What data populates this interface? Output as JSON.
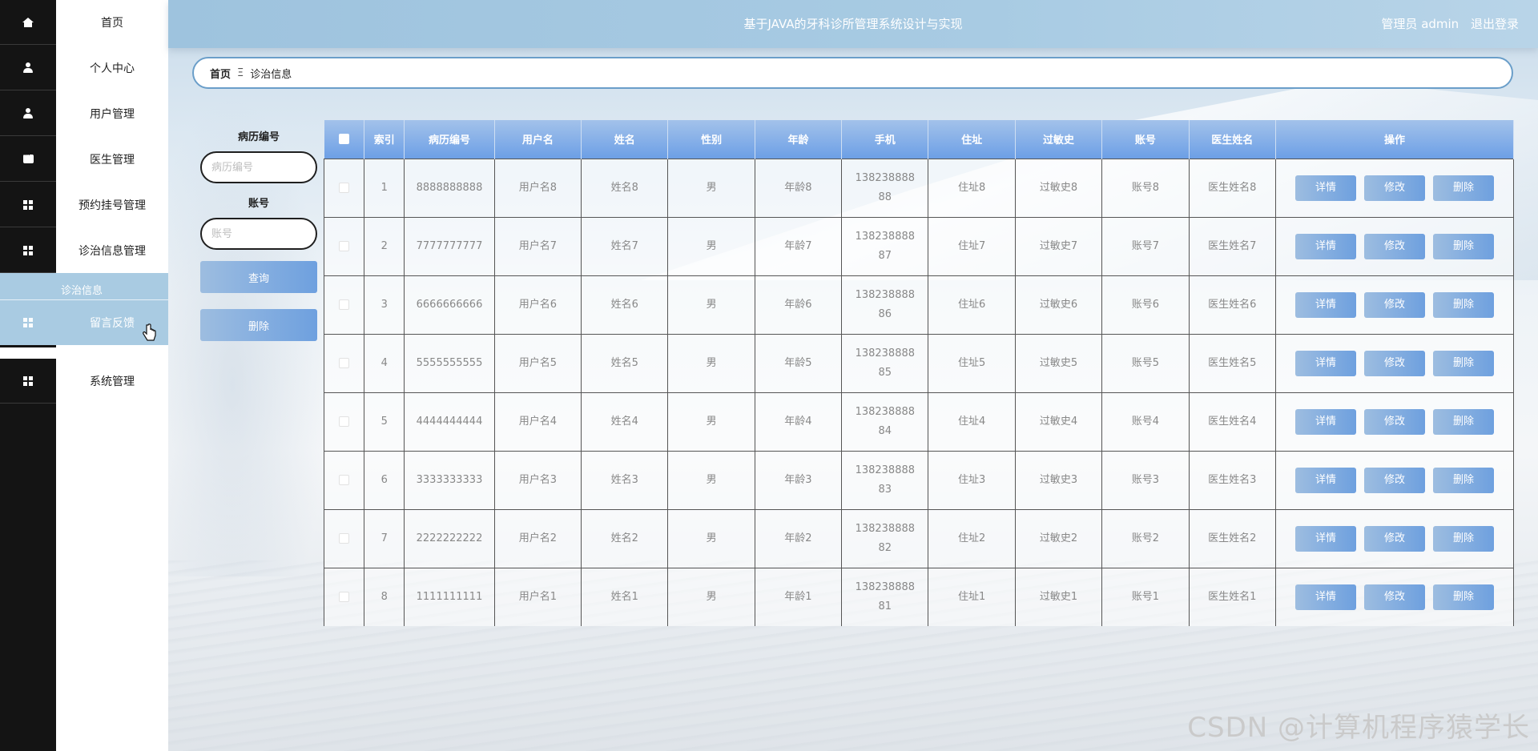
{
  "header": {
    "title": "基于JAVA的牙科诊所管理系统设计与实现",
    "user": "管理员 admin",
    "logout": "退出登录"
  },
  "sidebar": {
    "items": [
      {
        "label": "首页",
        "icon": "home-icon"
      },
      {
        "label": "个人中心",
        "icon": "user-icon"
      },
      {
        "label": "用户管理",
        "icon": "user-icon"
      },
      {
        "label": "医生管理",
        "icon": "chat-icon"
      },
      {
        "label": "预约挂号管理",
        "icon": "grid-icon"
      },
      {
        "label": "诊治信息管理",
        "icon": "grid-icon"
      },
      {
        "label": "留言反馈",
        "icon": "grid-icon"
      },
      {
        "label": "系统管理",
        "icon": "grid-icon"
      }
    ],
    "submenu_label": "诊治信息",
    "active_item": "留言反馈"
  },
  "breadcrumb": {
    "home": "首页",
    "separator": "Ξ",
    "current": "诊治信息"
  },
  "search": {
    "record_label": "病历编号",
    "record_placeholder": "病历编号",
    "account_label": "账号",
    "account_placeholder": "账号",
    "query_button": "查询",
    "delete_button": "删除"
  },
  "table": {
    "columns": [
      "",
      "索引",
      "病历编号",
      "用户名",
      "姓名",
      "性别",
      "年龄",
      "手机",
      "住址",
      "过敏史",
      "账号",
      "医生姓名",
      "操作"
    ],
    "actions": {
      "detail": "详情",
      "edit": "修改",
      "delete": "删除"
    },
    "rows": [
      {
        "index": "1",
        "record": "8888888888",
        "username": "用户名8",
        "name": "姓名8",
        "gender": "男",
        "age": "年龄8",
        "phone": "13823888888",
        "address": "住址8",
        "allergy": "过敏史8",
        "account": "账号8",
        "doctor": "医生姓名8"
      },
      {
        "index": "2",
        "record": "7777777777",
        "username": "用户名7",
        "name": "姓名7",
        "gender": "男",
        "age": "年龄7",
        "phone": "13823888887",
        "address": "住址7",
        "allergy": "过敏史7",
        "account": "账号7",
        "doctor": "医生姓名7"
      },
      {
        "index": "3",
        "record": "6666666666",
        "username": "用户名6",
        "name": "姓名6",
        "gender": "男",
        "age": "年龄6",
        "phone": "13823888886",
        "address": "住址6",
        "allergy": "过敏史6",
        "account": "账号6",
        "doctor": "医生姓名6"
      },
      {
        "index": "4",
        "record": "5555555555",
        "username": "用户名5",
        "name": "姓名5",
        "gender": "男",
        "age": "年龄5",
        "phone": "13823888885",
        "address": "住址5",
        "allergy": "过敏史5",
        "account": "账号5",
        "doctor": "医生姓名5"
      },
      {
        "index": "5",
        "record": "4444444444",
        "username": "用户名4",
        "name": "姓名4",
        "gender": "男",
        "age": "年龄4",
        "phone": "13823888884",
        "address": "住址4",
        "allergy": "过敏史4",
        "account": "账号4",
        "doctor": "医生姓名4"
      },
      {
        "index": "6",
        "record": "3333333333",
        "username": "用户名3",
        "name": "姓名3",
        "gender": "男",
        "age": "年龄3",
        "phone": "13823888883",
        "address": "住址3",
        "allergy": "过敏史3",
        "account": "账号3",
        "doctor": "医生姓名3"
      },
      {
        "index": "7",
        "record": "2222222222",
        "username": "用户名2",
        "name": "姓名2",
        "gender": "男",
        "age": "年龄2",
        "phone": "13823888882",
        "address": "住址2",
        "allergy": "过敏史2",
        "account": "账号2",
        "doctor": "医生姓名2"
      },
      {
        "index": "8",
        "record": "1111111111",
        "username": "用户名1",
        "name": "姓名1",
        "gender": "男",
        "age": "年龄1",
        "phone": "13823888881",
        "address": "住址1",
        "allergy": "过敏史1",
        "account": "账号1",
        "doctor": "医生姓名1"
      }
    ]
  },
  "watermark": "CSDN @计算机程序猿学长",
  "colors": {
    "header": "#a8cbe3",
    "sidebar_icon_strip": "#141414",
    "active_nav": "#a9cbe2",
    "button": "#6ea0df",
    "table_header": "#6c9fe6"
  }
}
